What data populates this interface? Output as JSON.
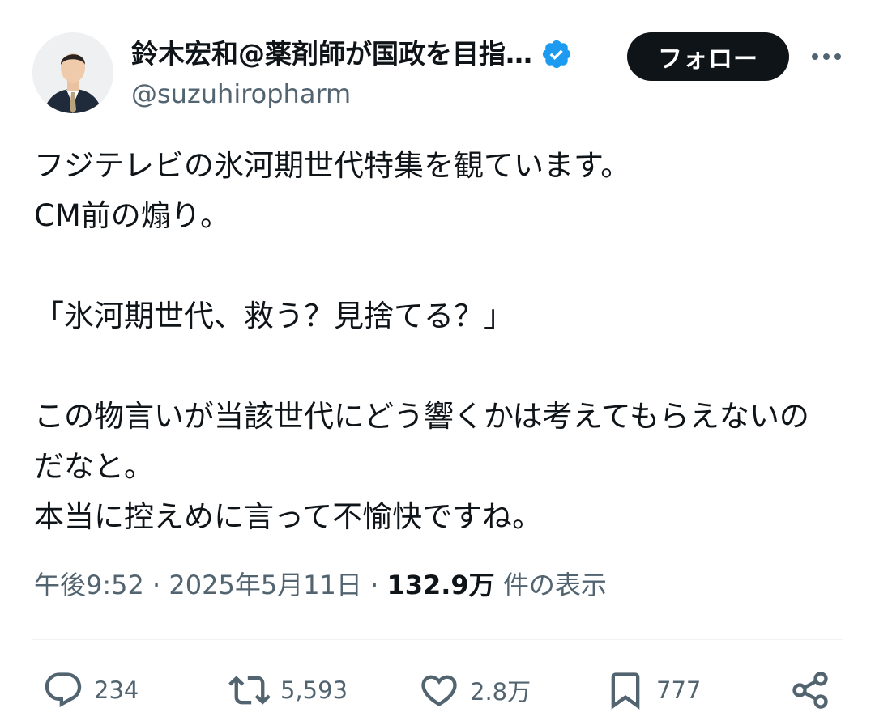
{
  "author": {
    "display_name": "鈴木宏和@薬剤師が国政を目指…",
    "handle": "@suzuhiropharm",
    "avatar_icon": "avatar-photo",
    "verified_icon": "verified-badge-icon",
    "verified_color": "#1d9bf0"
  },
  "header": {
    "follow_label": "フォロー",
    "more_icon": "more-options-icon"
  },
  "tweet": {
    "text": "フジテレビの氷河期世代特集を観ています。\nCM前の煽り。\n\n「氷河期世代、救う？見捨てる？」\n\nこの物言いが当該世代にどう響くかは考えてもらえないのだなと。\n本当に控えめに言って不愉快ですね。"
  },
  "meta": {
    "time": "午後9:52",
    "separator": "·",
    "date": "2025年5月11日",
    "views_count": "132.9万",
    "views_label": "件の表示"
  },
  "actions": {
    "reply": {
      "icon": "reply-icon",
      "count": "234"
    },
    "retweet": {
      "icon": "retweet-icon",
      "count": "5,593"
    },
    "like": {
      "icon": "heart-icon",
      "count": "2.8万"
    },
    "bookmark": {
      "icon": "bookmark-icon",
      "count": "777"
    },
    "share": {
      "icon": "share-icon"
    }
  },
  "colors": {
    "text_primary": "#0f1419",
    "text_secondary": "#536471",
    "follow_button_bg": "#0f1419",
    "divider": "#eff3f4"
  }
}
